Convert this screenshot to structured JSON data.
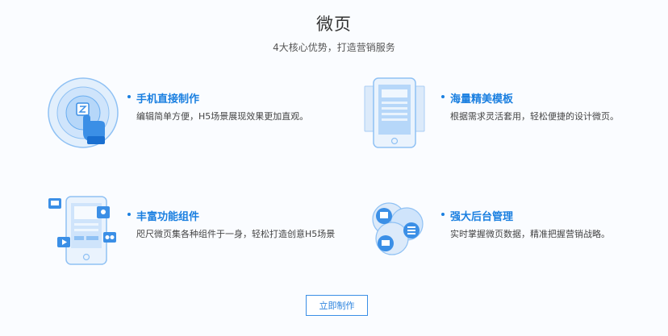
{
  "header": {
    "title": "微页",
    "subtitle": "4大核心优势，打造营销服务"
  },
  "features": [
    {
      "title": "手机直接制作",
      "description": "编辑简单方便，H5场景展现效果更加直观。",
      "icon": "hand-touch-circle-icon"
    },
    {
      "title": "海量精美模板",
      "description": "根据需求灵活套用，轻松便捷的设计微页。",
      "icon": "phone-templates-icon"
    },
    {
      "title": "丰富功能组件",
      "description": "咫尺微页集各种组件于一身，轻松打造创意H5场景",
      "icon": "phone-components-icon"
    },
    {
      "title": "强大后台管理",
      "description": "实时掌握微页数据，精准把握营销战略。",
      "icon": "backend-management-icon"
    }
  ],
  "cta": {
    "label": "立即制作"
  },
  "colors": {
    "accent": "#1a7fe0",
    "illustration_light": "#cfe4fb",
    "illustration_mid": "#8fc1f4",
    "illustration_dark": "#3b8fe6"
  }
}
